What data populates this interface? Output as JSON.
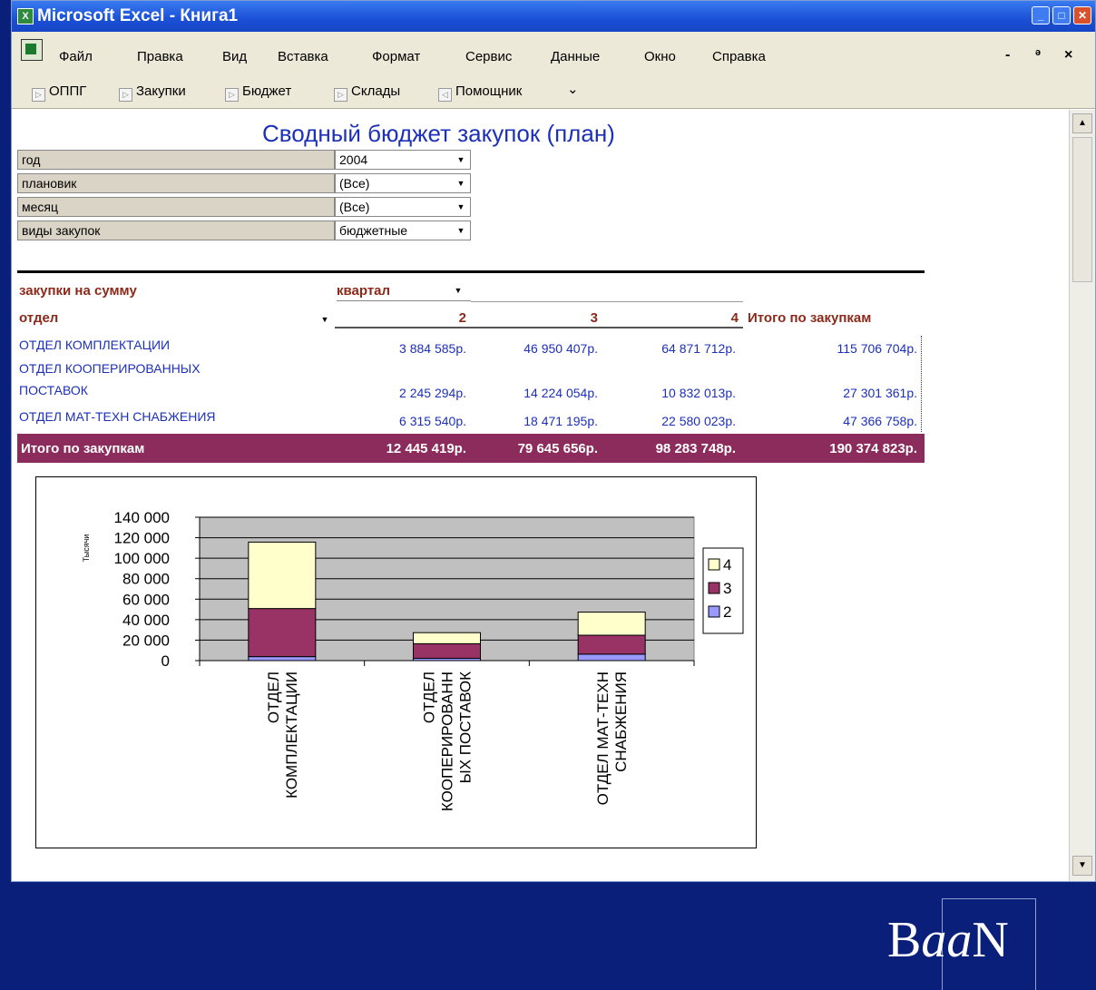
{
  "window": {
    "title": "Microsoft Excel - Книга1"
  },
  "menu": {
    "items": [
      {
        "label": "Файл",
        "key": "file"
      },
      {
        "label": "Правка",
        "key": "edit"
      },
      {
        "label": "Вид",
        "key": "view"
      },
      {
        "label": "Вставка",
        "key": "insert"
      },
      {
        "label": "Формат",
        "key": "format"
      },
      {
        "label": "Сервис",
        "key": "tools"
      },
      {
        "label": "Данные",
        "key": "data"
      },
      {
        "label": "Окно",
        "key": "window"
      },
      {
        "label": "Справка",
        "key": "help"
      }
    ]
  },
  "toolbar": {
    "items": [
      {
        "label": "ОППГ",
        "key": "oppg"
      },
      {
        "label": "Закупки",
        "key": "purchases"
      },
      {
        "label": "Бюджет",
        "key": "budget"
      },
      {
        "label": "Склады",
        "key": "warehouses"
      },
      {
        "label": "Помощник",
        "key": "assistant"
      }
    ],
    "overflow": "⌄"
  },
  "report": {
    "title": "Сводный бюджет закупок (план)",
    "page_fields": [
      {
        "label": "год",
        "value": "2004"
      },
      {
        "label": "плановик",
        "value": "(Все)"
      },
      {
        "label": "месяц",
        "value": "(Все)"
      },
      {
        "label": "виды закупок",
        "value": "бюджетные"
      }
    ],
    "data_field": "закупки на сумму",
    "column_field": "квартал",
    "row_field": "отдел",
    "columns": [
      "2",
      "3",
      "4",
      "Итого по закупкам"
    ],
    "rows": [
      {
        "name": [
          "ОТДЕЛ КОМПЛЕКТАЦИИ"
        ],
        "values": [
          "3 884 585р.",
          "46 950 407р.",
          "64 871 712р.",
          "115 706 704р."
        ]
      },
      {
        "name": [
          "ОТДЕЛ КООПЕРИРОВАННЫХ",
          "ПОСТАВОК"
        ],
        "values": [
          "2 245 294р.",
          "14 224 054р.",
          "10 832 013р.",
          "27 301 361р."
        ]
      },
      {
        "name": [
          "ОТДЕЛ МАТ-ТЕХН СНАБЖЕНИЯ"
        ],
        "values": [
          "6 315 540р.",
          "18 471 195р.",
          "22 580 023р.",
          "47 366 758р."
        ]
      }
    ],
    "total": {
      "label": "Итого по закупкам",
      "values": [
        "12 445 419р.",
        "79 645 656р.",
        "98 283 748р.",
        "190 374 823р."
      ]
    }
  },
  "chart_data": {
    "type": "bar",
    "stacked": true,
    "categories": [
      [
        "ОТДЕЛ",
        "КОМПЛЕКТАЦИИ"
      ],
      [
        "ОТДЕЛ",
        "КООПЕРИРОВАНН",
        "ЫХ ПОСТАВОК"
      ],
      [
        "ОТДЕЛ МАТ-ТЕХН",
        "СНАБЖЕНИЯ"
      ]
    ],
    "series": [
      {
        "name": "2",
        "color": "#9999ff",
        "values": [
          3885,
          2245,
          6316
        ]
      },
      {
        "name": "3",
        "color": "#993366",
        "values": [
          46950,
          14224,
          18471
        ]
      },
      {
        "name": "4",
        "color": "#ffffcc",
        "values": [
          64872,
          10832,
          22580
        ]
      }
    ],
    "ylabel": "Тысячи",
    "ylim": [
      0,
      140000
    ],
    "yticks": [
      "140 000",
      "120 000",
      "100 000",
      "80 000",
      "60 000",
      "40 000",
      "20 000",
      "0"
    ],
    "legend": [
      "4",
      "3",
      "2"
    ],
    "legend_position": "right",
    "plot_bg": "#c0c0c0",
    "grid": true
  },
  "logo": {
    "text_a": "B",
    "text_b": "aa",
    "text_c": "N"
  }
}
